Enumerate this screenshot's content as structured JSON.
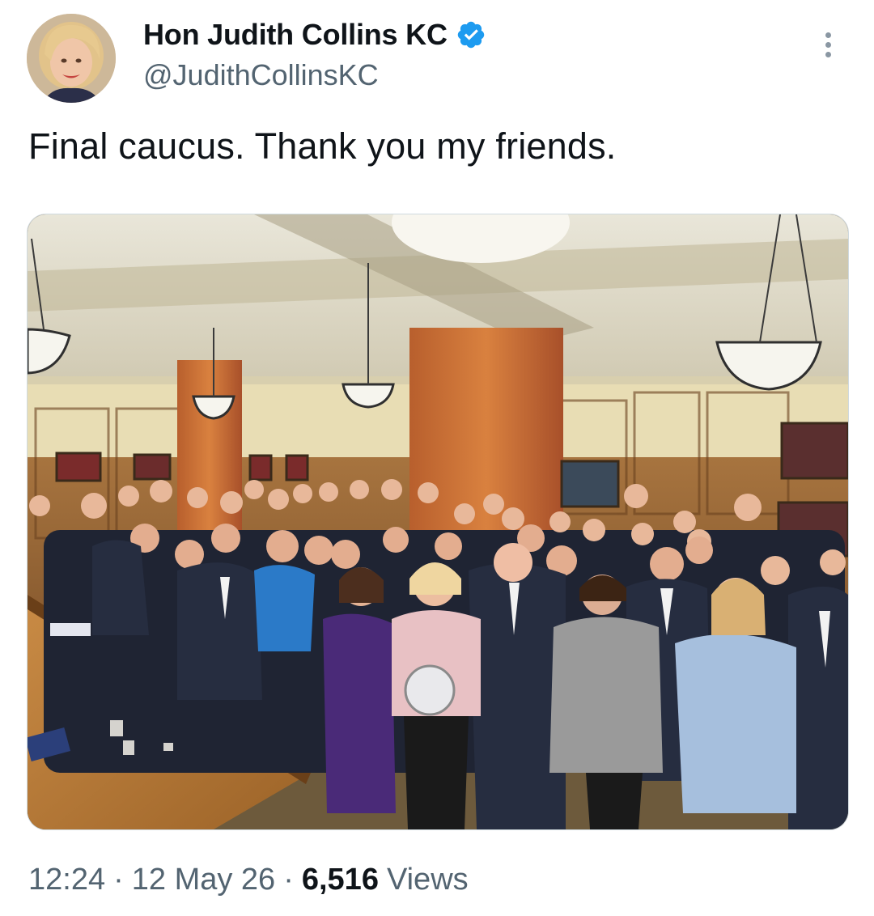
{
  "author": {
    "display_name": "Hon Judith Collins KC",
    "handle": "@JudithCollinsKC",
    "verified": true,
    "verified_color": "#1d9bf0"
  },
  "tweet": {
    "text": "Final caucus. Thank you my friends."
  },
  "media": {
    "kind": "photo",
    "alt": ""
  },
  "meta": {
    "time": "12:24",
    "separator": "·",
    "date": "12 May 26",
    "views_count": "6,516",
    "views_label": "Views"
  },
  "icons": {
    "more": "more-vertical-icon",
    "verified": "verified-badge-icon"
  },
  "colors": {
    "primary_text": "#0f1419",
    "secondary_text": "#536471",
    "accent": "#1d9bf0"
  }
}
